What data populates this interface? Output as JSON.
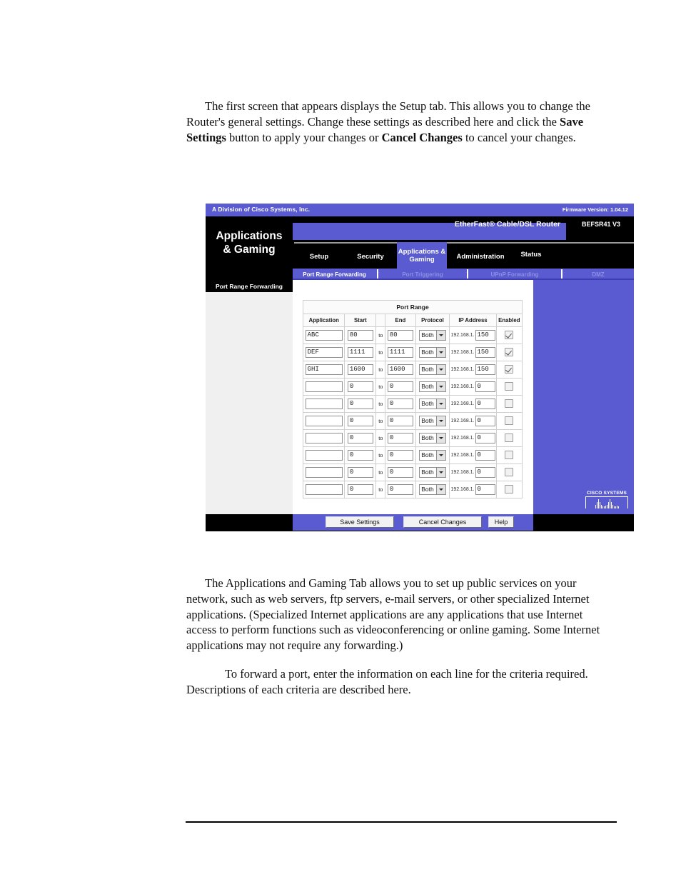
{
  "document": {
    "paragraph_1_parts": {
      "a": "The first screen that appears displays the Setup tab. This allows you to change the Router's general settings. Change these settings as described here and click the ",
      "b1": "Save Settings",
      "c": " button to apply your changes or ",
      "b2": "Cancel Changes",
      "d": " to cancel your changes."
    },
    "paragraph_2": "The Applications and Gaming Tab allows you to set up public services on your network, such as web servers, ftp servers, e-mail servers, or other specialized Internet applications. (Specialized Internet applications are any applications that use Internet access to perform functions such as videoconferencing or online gaming. Some Internet applications may not require any forwarding.)",
    "paragraph_3": "To forward a port, enter the information on each line for the criteria required. Descriptions of each criteria are described here."
  },
  "router_ui": {
    "brand": {
      "division_text": "A Division of Cisco Systems, Inc.",
      "firmware_text": "Firmware Version: 1.04.12"
    },
    "header": {
      "sidebar_title_line1": "Applications",
      "sidebar_title_line2": "& Gaming",
      "model_name": "EtherFast® Cable/DSL Router",
      "model_number": "BEFSR41 V3"
    },
    "tabs": [
      {
        "label": "Setup",
        "active": false
      },
      {
        "label": "Security",
        "active": false
      },
      {
        "label": "Applications & Gaming",
        "active": true
      },
      {
        "label": "Administration",
        "active": false
      },
      {
        "label": "Status",
        "active": false
      }
    ],
    "subtabs": [
      {
        "label": "Port Range Forwarding",
        "active": true
      },
      {
        "label": "Port Triggering",
        "active": false
      },
      {
        "label": "UPnP Forwarding",
        "active": false
      },
      {
        "label": "DMZ",
        "active": false
      }
    ],
    "section_label": "Port Range Forwarding",
    "table": {
      "title": "Port Range",
      "headers": [
        "Application",
        "Start",
        "End",
        "Protocol",
        "IP Address",
        "Enabled"
      ],
      "to_word": "to",
      "ip_prefix": "192.168.1.",
      "rows": [
        {
          "application": "ABC",
          "start": "80",
          "end": "80",
          "protocol": "Both",
          "ip_octet": "150",
          "enabled": true
        },
        {
          "application": "DEF",
          "start": "1111",
          "end": "1111",
          "protocol": "Both",
          "ip_octet": "150",
          "enabled": true
        },
        {
          "application": "GHI",
          "start": "1600",
          "end": "1600",
          "protocol": "Both",
          "ip_octet": "150",
          "enabled": true
        },
        {
          "application": "",
          "start": "0",
          "end": "0",
          "protocol": "Both",
          "ip_octet": "0",
          "enabled": false
        },
        {
          "application": "",
          "start": "0",
          "end": "0",
          "protocol": "Both",
          "ip_octet": "0",
          "enabled": false
        },
        {
          "application": "",
          "start": "0",
          "end": "0",
          "protocol": "Both",
          "ip_octet": "0",
          "enabled": false
        },
        {
          "application": "",
          "start": "0",
          "end": "0",
          "protocol": "Both",
          "ip_octet": "0",
          "enabled": false
        },
        {
          "application": "",
          "start": "0",
          "end": "0",
          "protocol": "Both",
          "ip_octet": "0",
          "enabled": false
        },
        {
          "application": "",
          "start": "0",
          "end": "0",
          "protocol": "Both",
          "ip_octet": "0",
          "enabled": false
        },
        {
          "application": "",
          "start": "0",
          "end": "0",
          "protocol": "Both",
          "ip_octet": "0",
          "enabled": false
        }
      ]
    },
    "footer": {
      "save_label": "Save Settings",
      "cancel_label": "Cancel Changes",
      "help_label": "Help"
    },
    "logo": {
      "text": "CISCO SYSTEMS"
    },
    "colors": {
      "accent_blue": "#5a5bd0",
      "panel_black": "#000000",
      "sidebar_gray": "#f0f0f0",
      "subtab_inactive": "#8e8fe0"
    }
  }
}
